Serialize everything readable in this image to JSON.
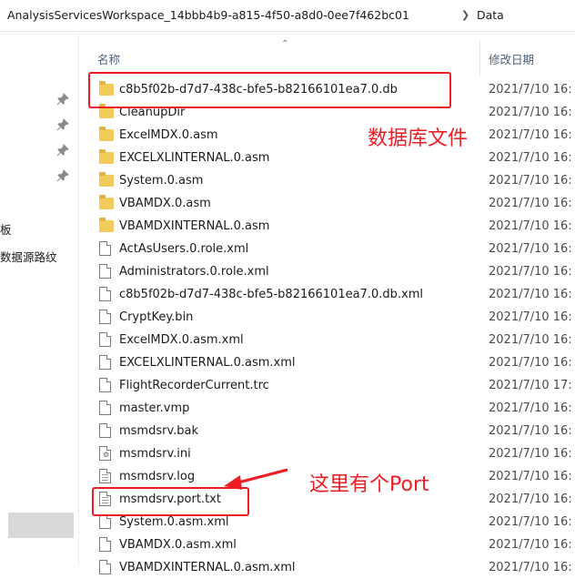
{
  "breadcrumb": {
    "path": "AnalysisServicesWorkspace_14bbb4b9-a815-4f50-a8d0-0ee7f462bc01",
    "current": "Data"
  },
  "nav": {
    "items": [
      "板",
      "数据源路纹"
    ]
  },
  "header": {
    "name_label": "名称",
    "date_label": "修改日期"
  },
  "files": [
    {
      "name": "c8b5f02b-d7d7-438c-bfe5-b82166101ea7.0.db",
      "date": "2021/7/10 16:",
      "icon": "folder-icon"
    },
    {
      "name": "CleanupDir",
      "date": "2021/7/10 16:",
      "icon": "folder-icon"
    },
    {
      "name": "ExcelMDX.0.asm",
      "date": "2021/7/10 16:",
      "icon": "folder-icon"
    },
    {
      "name": "EXCELXLINTERNAL.0.asm",
      "date": "2021/7/10 16:",
      "icon": "folder-icon"
    },
    {
      "name": "System.0.asm",
      "date": "2021/7/10 16:",
      "icon": "folder-icon"
    },
    {
      "name": "VBAMDX.0.asm",
      "date": "2021/7/10 16:",
      "icon": "folder-icon"
    },
    {
      "name": "VBAMDXINTERNAL.0.asm",
      "date": "2021/7/10 16:",
      "icon": "folder-icon"
    },
    {
      "name": "ActAsUsers.0.role.xml",
      "date": "2021/7/10 16:",
      "icon": "document-icon"
    },
    {
      "name": "Administrators.0.role.xml",
      "date": "2021/7/10 16:",
      "icon": "document-icon"
    },
    {
      "name": "c8b5f02b-d7d7-438c-bfe5-b82166101ea7.0.db.xml",
      "date": "2021/7/10 16:",
      "icon": "document-icon"
    },
    {
      "name": "CryptKey.bin",
      "date": "2021/7/10 16:",
      "icon": "document-icon"
    },
    {
      "name": "ExcelMDX.0.asm.xml",
      "date": "2021/7/10 16:",
      "icon": "document-icon"
    },
    {
      "name": "EXCELXLINTERNAL.0.asm.xml",
      "date": "2021/7/10 16:",
      "icon": "document-icon"
    },
    {
      "name": "FlightRecorderCurrent.trc",
      "date": "2021/7/10 17:",
      "icon": "document-icon"
    },
    {
      "name": "master.vmp",
      "date": "2021/7/10 16:",
      "icon": "document-icon"
    },
    {
      "name": "msmdsrv.bak",
      "date": "2021/7/10 16:",
      "icon": "document-icon"
    },
    {
      "name": "msmdsrv.ini",
      "date": "2021/7/10 16:",
      "icon": "settings-file-icon"
    },
    {
      "name": "msmdsrv.log",
      "date": "2021/7/10 16:",
      "icon": "text-file-icon"
    },
    {
      "name": "msmdsrv.port.txt",
      "date": "2021/7/10 16:",
      "icon": "text-file-icon"
    },
    {
      "name": "System.0.asm.xml",
      "date": "2021/7/10 16:",
      "icon": "document-icon"
    },
    {
      "name": "VBAMDX.0.asm.xml",
      "date": "2021/7/10 16:",
      "icon": "document-icon"
    },
    {
      "name": "VBAMDXINTERNAL.0.asm.xml",
      "date": "2021/7/10 16:",
      "icon": "document-icon"
    }
  ],
  "annotations": {
    "db_label": "数据库文件",
    "port_label": "这里有个Port",
    "color": "#ee1d23"
  }
}
